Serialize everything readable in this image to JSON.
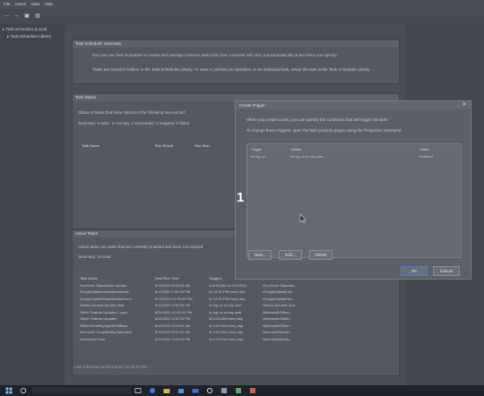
{
  "menu": [
    "File",
    "Action",
    "View",
    "Help"
  ],
  "tree": {
    "root": "Task Scheduler (Local)",
    "child": "Task Scheduler Library"
  },
  "overview": {
    "header": "Task Scheduler Summary",
    "line1": "You can use Task Scheduler to create and manage common tasks that your computer will carry out automatically at the times you specify.",
    "line2": "Tasks are stored in folders in the Task Scheduler Library. To view or perform an operation on an individual task, select the task in the Task Scheduler Library."
  },
  "status": {
    "header": "Task Status",
    "desc": "Status of tasks that have started in the following time period:",
    "summary": "Summary: 0 total - 0 running, 0 succeeded, 0 stopped, 0 failed",
    "cols": [
      "Task Name",
      "Run Result",
      "Run Start",
      "Run End"
    ]
  },
  "active": {
    "header": "Active Tasks",
    "desc": "Active tasks are tasks that are currently enabled and have not expired.",
    "summary": "Summary: 15 total",
    "cols": [
      "Task Name",
      "Next Run Time",
      "Triggers",
      "Location"
    ],
    "rows": [
      [
        "OneDrive Standalone Update...",
        "8/12/2020 6:53:29 AM",
        "At 6:53 AM on 5/1/2020",
        "\\OneDrive Standalo..."
      ],
      [
        "GoogleUpdateTaskMachineUA",
        "8/11/2020 1:30:00 PM",
        "At 12:30 PM every day",
        "\\GoogleUpdateTas..."
      ],
      [
        "GoogleUpdateTaskMachineCore",
        "8/12/2020 12:30:00 PM",
        "At 12:30 PM every day",
        "\\GoogleUpdateTas..."
      ],
      [
        "Adobe Acrobat Update Task",
        "8/11/2020 2:00:00 PM",
        "At log on of any user",
        "\\Adobe Acrobat Upd..."
      ],
      [
        "Office Feature Updates Logon",
        "8/11/2020 12:45:11 PM",
        "At log on of any user",
        "\\Microsoft\\Office\\..."
      ],
      [
        "Office Feature Updates",
        "8/11/2020 4:12:05 PM",
        "At 4:00 AM every day",
        "\\Microsoft\\Office\\..."
      ],
      [
        "OfficeTelemetryAgentFallBack",
        "8/12/2020 3:00:00 AM",
        "At 3:00 AM every day",
        "\\Microsoft\\Office\\..."
      ],
      [
        "Microsoft Compatibility Appraiser",
        "8/12/2020 3:40:22 AM",
        "At 3:00 AM every day",
        "\\Microsoft\\Windo..."
      ],
      [
        "Scheduled Start",
        "8/11/2020 2:43:44 PM",
        "At 2:43 PM every day",
        "\\Microsoft\\Windo..."
      ]
    ],
    "refreshed": "Last refreshed at 8/11/2020 12:38:11 PM"
  },
  "dialog": {
    "title": "Create Trigger",
    "intro": "When you create a task, you can specify the conditions that will trigger the task.",
    "intro2": "To change these triggers, open the task property pages using the Properties command.",
    "cols": [
      "Trigger",
      "Details",
      "Status"
    ],
    "row": [
      "At log on",
      "At log on of any user",
      "Enabled"
    ],
    "btn_new": "New...",
    "btn_edit": "Edit...",
    "btn_delete": "Delete",
    "btn_ok": "OK",
    "btn_cancel": "Cancel",
    "close": "✕"
  },
  "step_number": "1",
  "colors": {
    "overlay": "#3a3f48",
    "taskbar": "#1e2229",
    "accent": "#3f7fd4"
  }
}
